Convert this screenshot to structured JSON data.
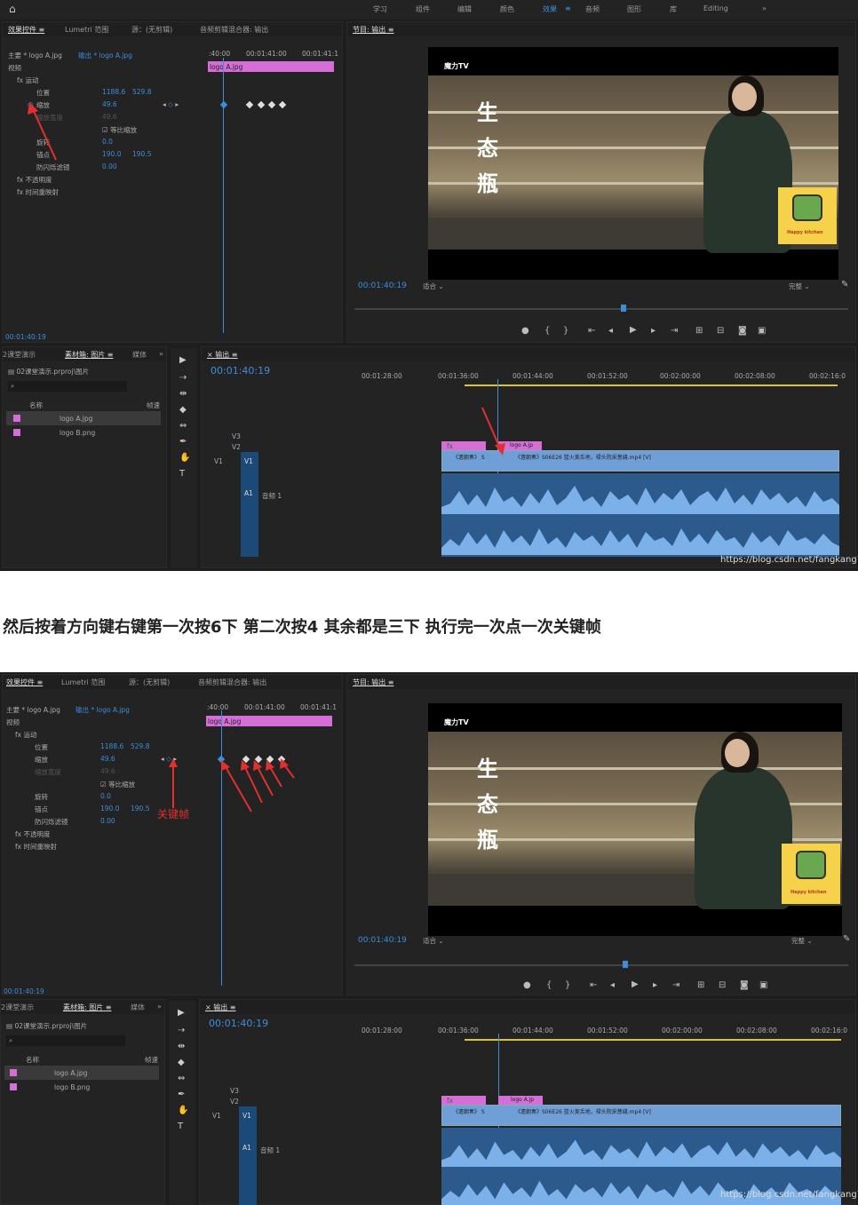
{
  "caption": "然后按着方向键右键第一次按6下 第二次按4 其余都是三下 执行完一次点一次关键帧",
  "workspace_tabs": [
    "学习",
    "组件",
    "编辑",
    "颜色",
    "效果",
    "≡",
    "音频",
    "图形",
    "库",
    "Editing",
    "»"
  ],
  "effect_controls": {
    "tabs": [
      "效果控件 ≡",
      "Lumetri 范围",
      "源：(无剪辑)",
      "音频剪辑混合器: 输出"
    ],
    "master": "主要 * logo A.jpg",
    "sequence": "输出 * logo A.jpg",
    "video_label": "视频",
    "timecodes": [
      ":40:00",
      "00:01:41:00",
      "00:01:41:1"
    ],
    "clip_label": "logo A.jpg",
    "motion": "运动",
    "position_label": "位置",
    "position_x": "1188.6",
    "position_y": "529.8",
    "scale_label": "缩放",
    "scale_value": "49.6",
    "scale_width_label": "缩放宽度",
    "scale_width_value": "49.6",
    "uniform_scale": "等比缩放",
    "rotation_label": "旋转",
    "rotation_value": "0.0",
    "anchor_label": "锚点",
    "anchor_x": "190.0",
    "anchor_y": "190.5",
    "flicker_label": "防闪烁滤镜",
    "flicker_value": "0.00",
    "opacity_label": "不透明度",
    "time_remap_label": "时间重映射",
    "bottom_time": "00:01:40:19",
    "keyframe_label": "关键帧"
  },
  "program_monitor": {
    "title": "节目: 输出 ≡",
    "tv_label": "魔力TV",
    "chars": [
      "生",
      "态",
      "瓶"
    ],
    "logo_text": "Happy kitchen",
    "timecode": "00:01:40:19",
    "fit": "适合",
    "quality": "完整"
  },
  "project_panel": {
    "tabs": [
      "2课堂演示",
      "素材箱: 图片 ≡",
      "媒体",
      "»"
    ],
    "path": "02课堂演示.prproj\\图片",
    "name_header": "名称",
    "fps_header": "帧速",
    "items": [
      "logo A.jpg",
      "logo B.png"
    ]
  },
  "timeline": {
    "title": "输出 ≡",
    "timecode": "00:01:40:19",
    "ruler": [
      "00:01:28:00",
      "00:01:36:00",
      "00:01:44:00",
      "00:01:52:00",
      "00:02:00:00",
      "00:02:08:00",
      "00:02:16:0"
    ],
    "tracks_video": [
      "V3",
      "V2",
      "V1"
    ],
    "tracks_audio": [
      "A1"
    ],
    "audio_label": "音频 1",
    "clip_logo_a": "logo A.jp",
    "clip_fx": "fx",
    "clip_video": "《遗朝奏》S06E26 篮火美舌地，禄头院采葱缝.mp4 [V]",
    "clip_video_short": "《遗朝奏》 S",
    "watermark": "https://blog.csdn.net/fangkang7"
  },
  "colors": {
    "accent": "#3d8ddb",
    "pink": "#d56ed6",
    "audio": "#6f9fd6",
    "arrow": "#e03030"
  }
}
